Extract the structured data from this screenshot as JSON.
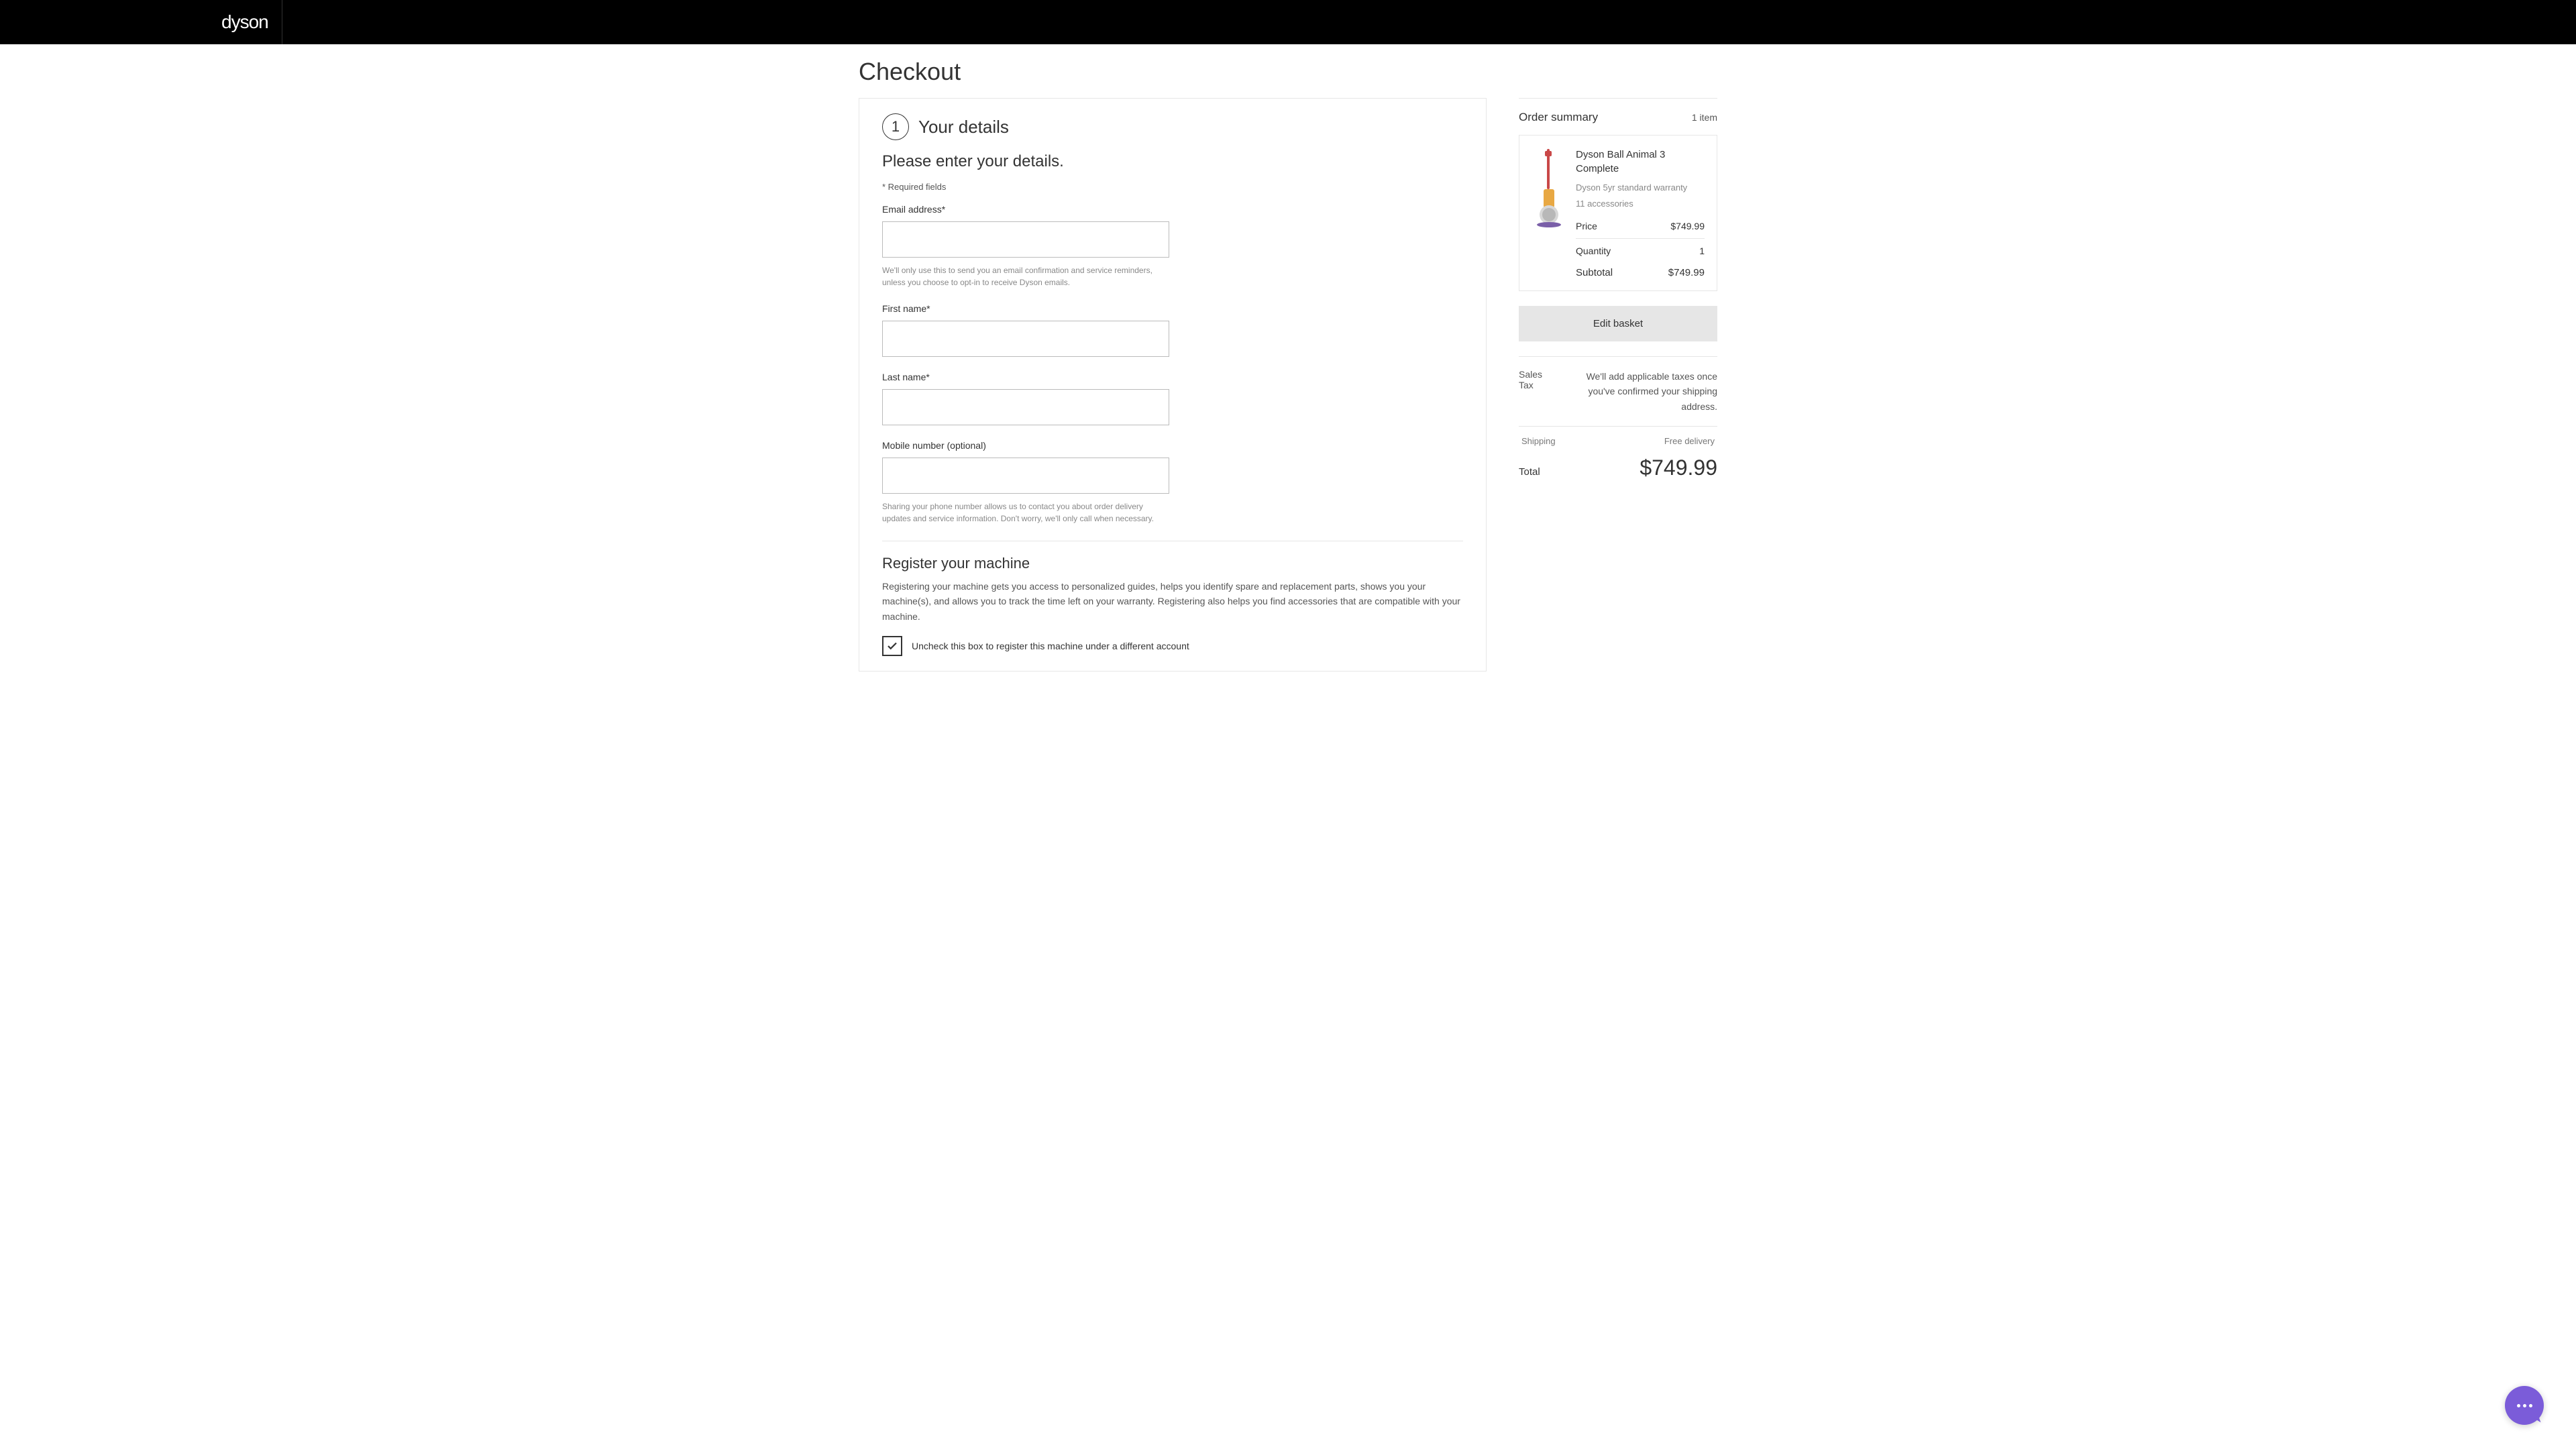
{
  "header": {
    "logo": "dyson"
  },
  "page": {
    "title": "Checkout"
  },
  "step": {
    "number": "1",
    "title": "Your details"
  },
  "form": {
    "heading": "Please enter your details.",
    "required_note": "* Required fields",
    "email": {
      "label": "Email address*",
      "help": "We'll only use this to send you an email confirmation and service reminders, unless you choose to opt-in to receive Dyson emails."
    },
    "first_name": {
      "label": "First name*"
    },
    "last_name": {
      "label": "Last name*"
    },
    "mobile": {
      "label": "Mobile number (optional)",
      "help": "Sharing your phone number allows us to contact you about order delivery updates and service information. Don't worry, we'll only call when necessary."
    }
  },
  "register": {
    "heading": "Register your machine",
    "desc": "Registering your machine gets you access to personalized guides, helps you identify spare and replacement parts, shows you your machine(s), and allows you to track the time left on your warranty. Registering also helps you find accessories that are compatible with your machine.",
    "checkbox_label": "Uncheck this box to register this machine under a different account"
  },
  "summary": {
    "title": "Order summary",
    "count": "1 item",
    "product": {
      "name": "Dyson Ball Animal 3 Complete",
      "warranty": "Dyson 5yr standard warranty",
      "accessories": "11 accessories",
      "price_label": "Price",
      "price": "$749.99",
      "qty_label": "Quantity",
      "qty": "1",
      "subtotal_label": "Subtotal",
      "subtotal": "$749.99"
    },
    "edit_basket": "Edit basket",
    "tax_label": "Sales Tax",
    "tax_note": "We'll add applicable taxes once you've confirmed your shipping address.",
    "shipping_label": "Shipping",
    "shipping_value": "Free delivery",
    "total_label": "Total",
    "total_value": "$749.99"
  }
}
